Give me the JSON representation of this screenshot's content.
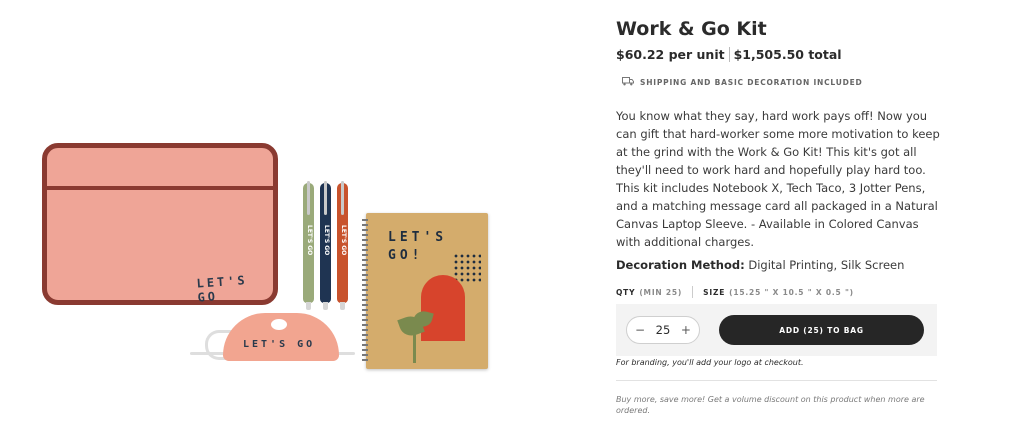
{
  "product": {
    "title": "Work & Go Kit",
    "price_unit": "$60.22 per unit",
    "price_total": "$1,505.50 total",
    "shipping_note": "SHIPPING AND BASIC DECORATION INCLUDED",
    "description": "You know what they say, hard work pays off! Now you can gift that hard-worker some more motivation to keep at the grind with the Work & Go Kit! This kit's got all they'll need to work hard and hopefully play hard too. This kit includes Notebook X, Tech Taco, 3 Jotter Pens, and a matching message card all packaged in a Natural Canvas Laptop Sleeve. - Available in Colored Canvas with additional charges.",
    "decoration_label": "Decoration Method:",
    "decoration_value": "Digital Printing, Silk Screen"
  },
  "image": {
    "sleeve_logo": "LET'S GO",
    "taco_logo": "LET'S GO",
    "notebook_title": "LET'S GO!",
    "pen_label": "LET'S GO"
  },
  "specs": {
    "qty_label": "QTY",
    "qty_min": "(MIN 25)",
    "size_label": "SIZE",
    "size_value": "(15.25 \" X 10.5 \" X 0.5 \")"
  },
  "cart": {
    "minus": "−",
    "quantity": "25",
    "plus": "+",
    "add_button": "ADD (25) TO BAG",
    "branding_note": "For branding, you'll add your logo at checkout.",
    "volume_note": "Buy more, save more! Get a volume discount on this product when more are ordered."
  },
  "icons": {
    "shipping": "truck-icon"
  },
  "colors": {
    "button": "#262626",
    "sleeve": "#efa597",
    "sleeve_trim": "#8a3a31"
  }
}
